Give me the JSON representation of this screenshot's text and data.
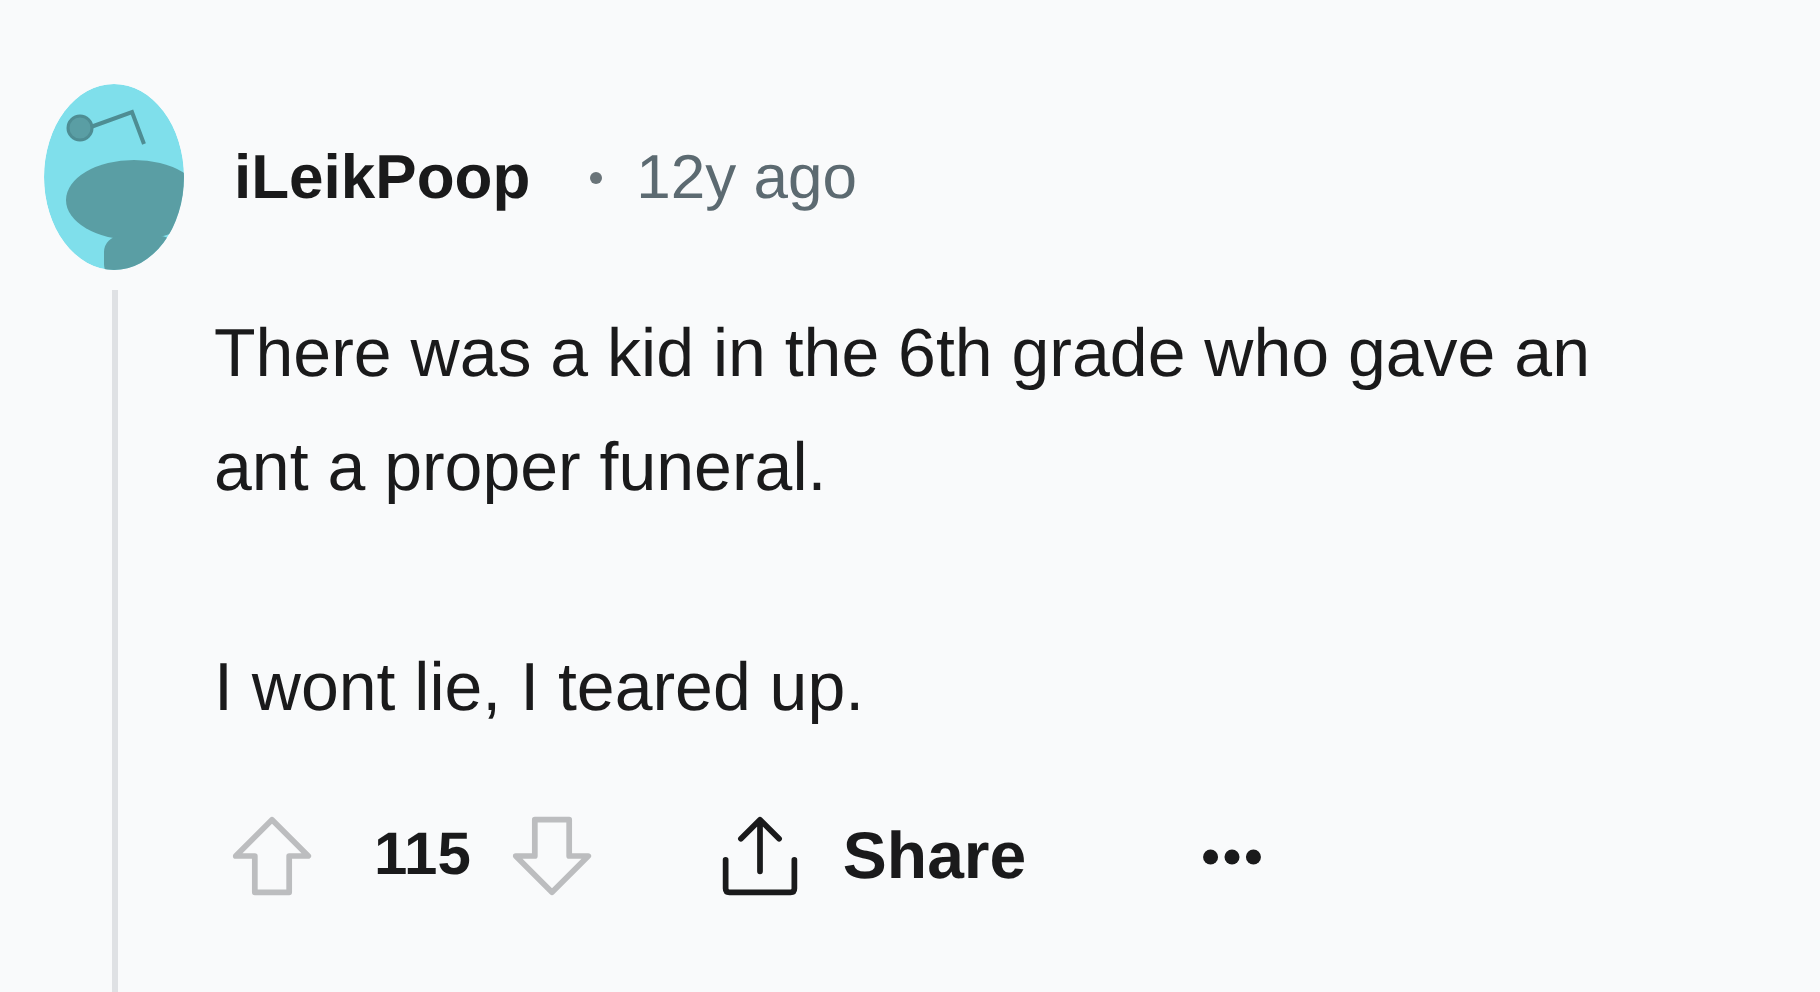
{
  "comment": {
    "author": "iLeikPoop",
    "age": "12y ago",
    "paragraphs": [
      "There was a kid in the 6th grade who gave an ant a proper funeral.",
      "I wont lie, I teared up."
    ],
    "score": "115",
    "share_label": "Share"
  }
}
